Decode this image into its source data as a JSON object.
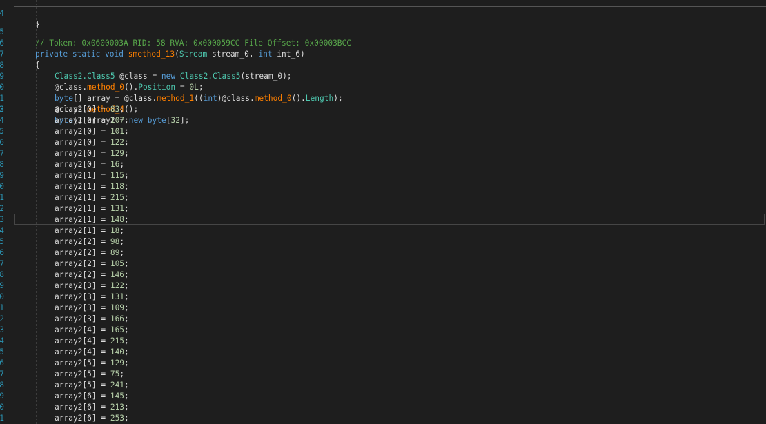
{
  "line_numbers": [
    "4",
    "5",
    "6",
    "7",
    "8",
    "9",
    "0",
    "1",
    "2",
    "3",
    "4",
    "5",
    "6",
    "7",
    "8",
    "9",
    "0",
    "1",
    "2",
    "3",
    "4",
    "5",
    "6",
    "7",
    "8",
    "9",
    "0",
    "1",
    "2",
    "3",
    "4",
    "5",
    "6",
    "7",
    "8",
    "9",
    "0",
    "1"
  ],
  "code": {
    "brace_close": "}",
    "comment": "// Token: 0x0600003A RID: 58 RVA: 0x000059CC File Offset: 0x00003BCC",
    "sig_kw": "private static void ",
    "sig_method": "smethod_13",
    "sig_paren_open": "(",
    "sig_type": "Stream",
    "sig_param1": " stream_0, ",
    "sig_kw2": "int",
    "sig_param2": " int_6)",
    "brace_open": "{",
    "l1_type1": "Class2.Class5",
    "l1_mid": " @class = ",
    "l1_new": "new",
    "l1_sp": " ",
    "l1_type2": "Class2.Class5",
    "l1_end": "(stream_0);",
    "l2_start": "@class.",
    "l2_method": "method_0",
    "l2_mid": "().",
    "l2_prop": "Position",
    "l2_eq": " = ",
    "l2_num": "0L",
    "l2_end": ";",
    "l3_kw": "byte",
    "l3_mid": "[] array = @class.",
    "l3_method": "method_1",
    "l3_paren": "((",
    "l3_int": "int",
    "l3_mid2": ")@class.",
    "l3_method2": "method_0",
    "l3_mid3": "().",
    "l3_prop": "Length",
    "l3_end": ");",
    "l4_start": "@class.",
    "l4_method": "method_4",
    "l4_end": "();",
    "l5_kw": "byte",
    "l5_mid": "[] array2 = ",
    "l5_new": "new",
    "l5_sp": " ",
    "l5_kw2": "byte",
    "l5_lb": "[",
    "l5_num": "32",
    "l5_end": "];"
  },
  "assignments": [
    {
      "idx": "0",
      "val": "83"
    },
    {
      "idx": "0",
      "val": "107"
    },
    {
      "idx": "0",
      "val": "101"
    },
    {
      "idx": "0",
      "val": "122"
    },
    {
      "idx": "0",
      "val": "129"
    },
    {
      "idx": "0",
      "val": "16"
    },
    {
      "idx": "1",
      "val": "115"
    },
    {
      "idx": "1",
      "val": "118"
    },
    {
      "idx": "1",
      "val": "215"
    },
    {
      "idx": "1",
      "val": "131"
    },
    {
      "idx": "1",
      "val": "148"
    },
    {
      "idx": "1",
      "val": "18"
    },
    {
      "idx": "2",
      "val": "98"
    },
    {
      "idx": "2",
      "val": "89"
    },
    {
      "idx": "2",
      "val": "105"
    },
    {
      "idx": "2",
      "val": "146"
    },
    {
      "idx": "3",
      "val": "122"
    },
    {
      "idx": "3",
      "val": "131"
    },
    {
      "idx": "3",
      "val": "109"
    },
    {
      "idx": "3",
      "val": "166"
    },
    {
      "idx": "4",
      "val": "165"
    },
    {
      "idx": "4",
      "val": "215"
    },
    {
      "idx": "4",
      "val": "140"
    },
    {
      "idx": "5",
      "val": "129"
    },
    {
      "idx": "5",
      "val": "75"
    },
    {
      "idx": "5",
      "val": "241"
    },
    {
      "idx": "6",
      "val": "145"
    },
    {
      "idx": "6",
      "val": "213"
    },
    {
      "idx": "6",
      "val": "253"
    }
  ],
  "assign_prefix": "array2[",
  "assign_mid": "] = ",
  "assign_end": ";",
  "colors": {
    "background": "#1e1e1e",
    "keyword": "#569cd6",
    "type": "#4ec9b0",
    "method": "#ff8000",
    "comment": "#57a64a",
    "number": "#b5cea8",
    "text": "#dcdcdc",
    "line_number": "#2b91af"
  }
}
